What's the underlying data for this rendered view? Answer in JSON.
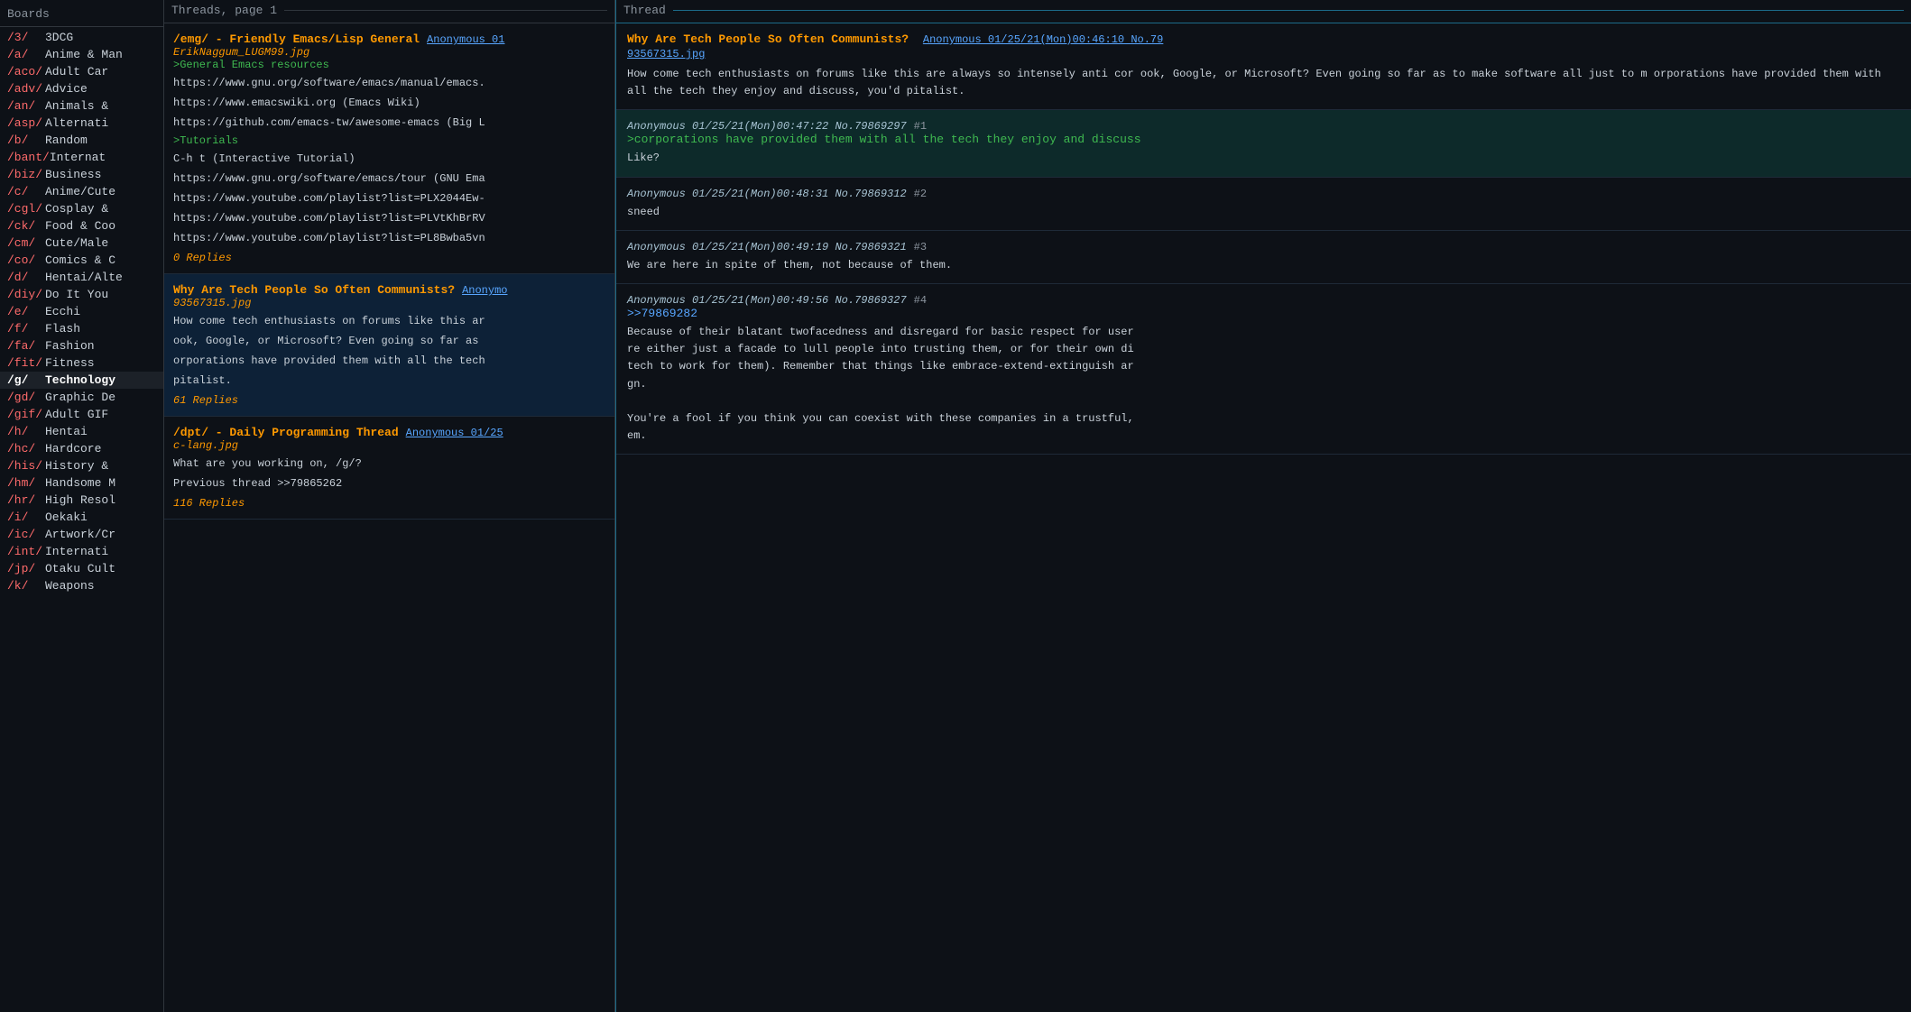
{
  "sidebar": {
    "header": "Boards",
    "items": [
      {
        "id": "/3/",
        "name": "3DCG"
      },
      {
        "id": "/a/",
        "name": "Anime & Man"
      },
      {
        "id": "/aco/",
        "name": "Adult Car"
      },
      {
        "id": "/adv/",
        "name": "Advice"
      },
      {
        "id": "/an/",
        "name": "Animals &"
      },
      {
        "id": "/asp/",
        "name": "Alternati"
      },
      {
        "id": "/b/",
        "name": "Random"
      },
      {
        "id": "/bant/",
        "name": "Internat"
      },
      {
        "id": "/biz/",
        "name": "Business"
      },
      {
        "id": "/c/",
        "name": "Anime/Cute"
      },
      {
        "id": "/cgl/",
        "name": "Cosplay &"
      },
      {
        "id": "/ck/",
        "name": "Food & Coo"
      },
      {
        "id": "/cm/",
        "name": "Cute/Male"
      },
      {
        "id": "/co/",
        "name": "Comics & C"
      },
      {
        "id": "/d/",
        "name": "Hentai/Alte"
      },
      {
        "id": "/diy/",
        "name": "Do It You"
      },
      {
        "id": "/e/",
        "name": "Ecchi"
      },
      {
        "id": "/f/",
        "name": "Flash"
      },
      {
        "id": "/fa/",
        "name": "Fashion"
      },
      {
        "id": "/fit/",
        "name": "Fitness"
      },
      {
        "id": "/g/",
        "name": "Technology",
        "active": true
      },
      {
        "id": "/gd/",
        "name": "Graphic De"
      },
      {
        "id": "/gif/",
        "name": "Adult GIF"
      },
      {
        "id": "/h/",
        "name": "Hentai"
      },
      {
        "id": "/hc/",
        "name": "Hardcore"
      },
      {
        "id": "/his/",
        "name": "History &"
      },
      {
        "id": "/hm/",
        "name": "Handsome M"
      },
      {
        "id": "/hr/",
        "name": "High Resol"
      },
      {
        "id": "/i/",
        "name": "Oekaki"
      },
      {
        "id": "/ic/",
        "name": "Artwork/Cr"
      },
      {
        "id": "/int/",
        "name": "Internati"
      },
      {
        "id": "/jp/",
        "name": "Otaku Cult"
      },
      {
        "id": "/k/",
        "name": "Weapons"
      }
    ]
  },
  "threads_panel": {
    "header": "Threads, page 1",
    "threads": [
      {
        "id": "emg",
        "title": "/emg/ - Friendly Emacs/Lisp General",
        "author": "Anonymous 01",
        "file": "ErikNaggum_LUGM99.jpg",
        "body_lines": [
          ">General Emacs resources",
          "https://www.gnu.org/software/emacs/manual/emacs.",
          "https://www.emacswiki.org (Emacs Wiki)",
          "https://github.com/emacs-tw/awesome-emacs (Big L",
          "",
          ">Tutorials",
          "C-h t (Interactive Tutorial)",
          "https://www.gnu.org/software/emacs/tour (GNU Ema",
          "https://www.youtube.com/playlist?list=PLX2044Ew-",
          "https://www.youtube.com/playlist?list=PLVtKhBrRV",
          "https://www.youtube.com/playlist?list=PL8Bwba5vn"
        ],
        "replies": "0 Replies",
        "selected": false
      },
      {
        "id": "why-tech",
        "title": "Why Are Tech People So Often Communists?",
        "author": "Anonymo",
        "file": "93567315.jpg",
        "body_lines": [
          "How come tech enthusiasts on forums like this ar",
          "ook, Google, or Microsoft? Even going so far as",
          "orporations have provided them with all the tech",
          "pitalist."
        ],
        "replies": "61 Replies",
        "selected": true
      },
      {
        "id": "dpt",
        "title": "/dpt/ - Daily Programming Thread",
        "author": "Anonymous 01/25",
        "file": "c-lang.jpg",
        "body_lines": [
          "What are you working on, /g/?",
          "",
          "Previous thread >>79865262"
        ],
        "replies": "116 Replies",
        "selected": false
      }
    ]
  },
  "thread_panel": {
    "header": "Thread",
    "op": {
      "title": "Why Are Tech People So Often Communists?",
      "meta": "Anonymous 01/25/21(Mon)00:46:10 No.79",
      "file": "93567315.jpg",
      "body": "How come tech enthusiasts on forums like this are always so intensely anti cor\nook, Google, or Microsoft? Even going so far as to make software all just to m\norporations have provided them with all the tech they enjoy and discuss, you'd\npitalist."
    },
    "posts": [
      {
        "id": "p1",
        "meta": "Anonymous  01/25/21(Mon)00:47:22  No.79869297",
        "num": "#1",
        "highlighted": true,
        "body_parts": [
          {
            "type": "greentext",
            "text": ">corporations have provided them with all the tech they enjoy and discuss"
          },
          {
            "type": "normal",
            "text": "Like?"
          }
        ]
      },
      {
        "id": "p2",
        "meta": "Anonymous  01/25/21(Mon)00:48:31  No.79869312",
        "num": "#2",
        "highlighted": false,
        "body_parts": [
          {
            "type": "normal",
            "text": "sneed"
          }
        ]
      },
      {
        "id": "p3",
        "meta": "Anonymous  01/25/21(Mon)00:49:19  No.79869321",
        "num": "#3",
        "highlighted": false,
        "body_parts": [
          {
            "type": "normal",
            "text": "We are here in spite of them, not because of them."
          }
        ]
      },
      {
        "id": "p4",
        "meta": "Anonymous  01/25/21(Mon)00:49:56  No.79869327",
        "num": "#4",
        "highlighted": false,
        "body_parts": [
          {
            "type": "quote",
            "text": ">>79869282"
          },
          {
            "type": "normal",
            "text": "Because of their blatant twofacedness and disregard for basic respect for user\nre either just a facade to lull people into trusting them, or for their own di\ntech to work for them). Remember that things like embrace-extend-extinguish ar\ngn.\n\nYou're a fool if you think you can coexist with these companies in a trustful,\nem."
          }
        ]
      }
    ]
  }
}
